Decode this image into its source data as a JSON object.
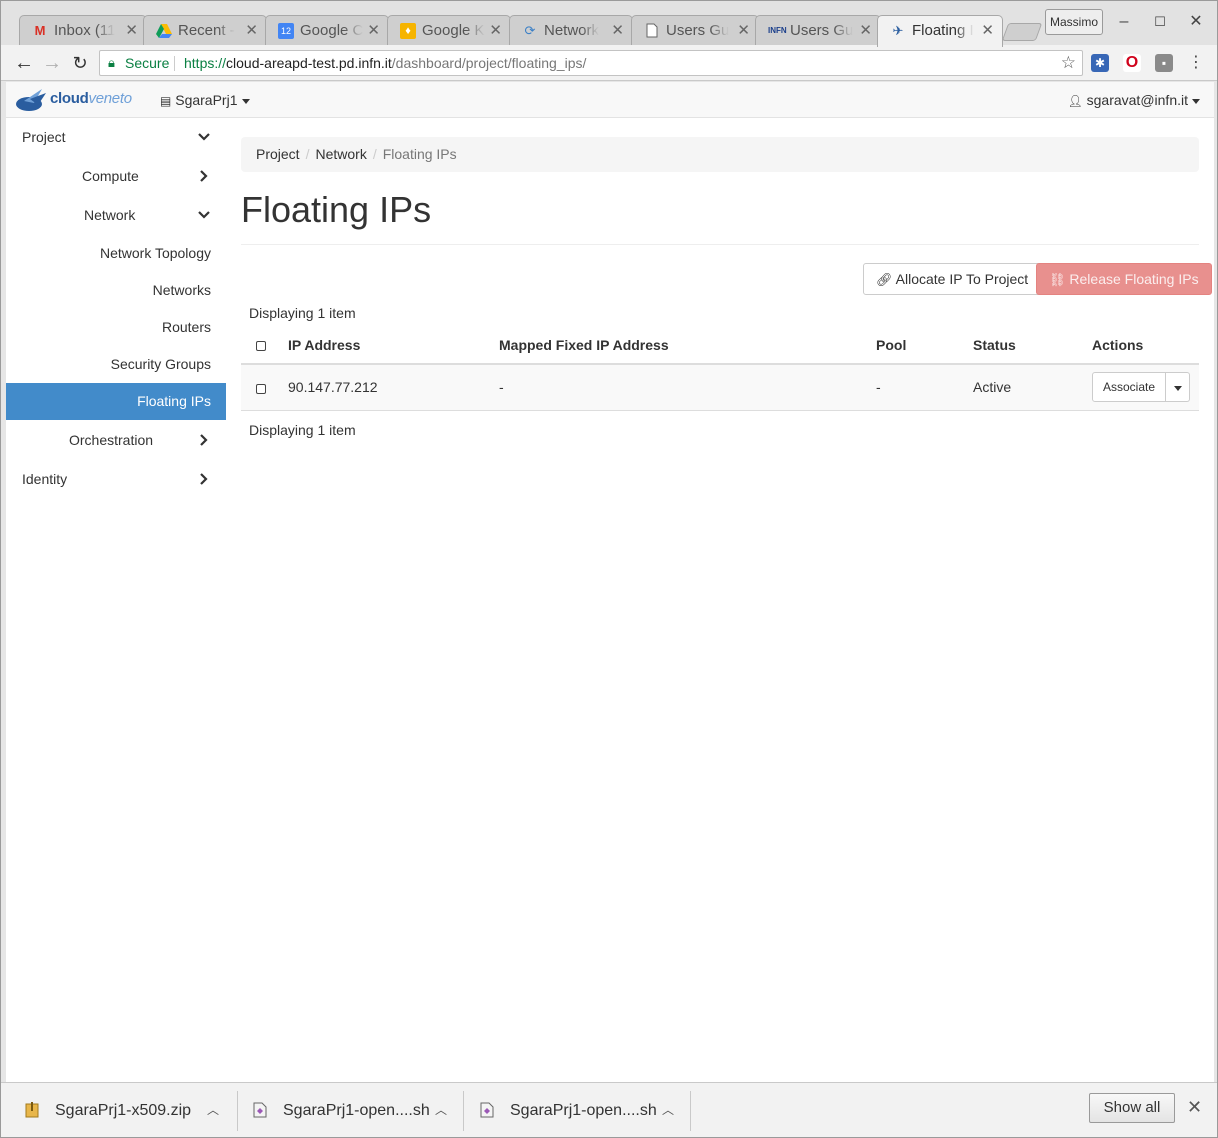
{
  "browser": {
    "tabs": [
      {
        "label": "Inbox (11",
        "icon": "gmail-icon"
      },
      {
        "label": "Recent - ",
        "icon": "drive-icon"
      },
      {
        "label": "Google C",
        "icon": "calendar-icon"
      },
      {
        "label": "Google K",
        "icon": "keep-icon"
      },
      {
        "label": "Network",
        "icon": "network-icon"
      },
      {
        "label": "Users Gu",
        "icon": "document-icon"
      },
      {
        "label": "Users Gu",
        "icon": "infn-icon"
      },
      {
        "label": "Floating I",
        "icon": "cloudveneto-icon"
      }
    ],
    "profile": "Massimo",
    "security_label": "Secure",
    "url": {
      "scheme": "https://",
      "host": "cloud-areapd-test.pd.infn.it",
      "path": "/dashboard/project/floating_ips/"
    }
  },
  "app": {
    "logo": {
      "bold": "cloud",
      "thin": "veneto"
    },
    "project": "SgaraPrj1",
    "user": "sgaravat@infn.it"
  },
  "sidebar": {
    "project": "Project",
    "compute": "Compute",
    "network": "Network",
    "network_topology": "Network Topology",
    "networks": "Networks",
    "routers": "Routers",
    "security_groups": "Security Groups",
    "floating_ips": "Floating IPs",
    "orchestration": "Orchestration",
    "identity": "Identity"
  },
  "breadcrumb": [
    "Project",
    "Network",
    "Floating IPs"
  ],
  "page_title": "Floating IPs",
  "actions": {
    "allocate": "Allocate IP To Project",
    "release": "Release Floating IPs"
  },
  "table": {
    "count_text": "Displaying 1 item",
    "columns": [
      "IP Address",
      "Mapped Fixed IP Address",
      "Pool",
      "Status",
      "Actions"
    ],
    "rows": [
      {
        "ip": "90.147.77.212",
        "mapped": "-",
        "pool": "-",
        "status": "Active",
        "action": "Associate"
      }
    ]
  },
  "downloads": {
    "items": [
      "SgaraPrj1-x509.zip",
      "SgaraPrj1-open....sh",
      "SgaraPrj1-open....sh"
    ],
    "show_all": "Show all"
  }
}
